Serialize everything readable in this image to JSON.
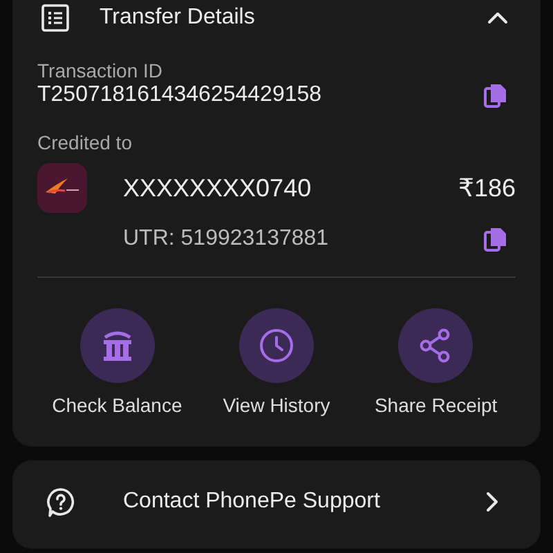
{
  "header": {
    "title": "Transfer Details",
    "expanded": true
  },
  "transaction": {
    "label": "Transaction ID",
    "value": "T2507181614346254429158"
  },
  "credited": {
    "label": "Credited to",
    "account": "XXXXXXXX0740",
    "amount": "₹186",
    "utr": "UTR: 519923137881"
  },
  "actions": [
    {
      "kind": "bank",
      "label": "Check Balance"
    },
    {
      "kind": "history",
      "label": "View History"
    },
    {
      "kind": "share",
      "label": "Share Receipt"
    }
  ],
  "support": {
    "label": "Contact PhonePe Support"
  }
}
